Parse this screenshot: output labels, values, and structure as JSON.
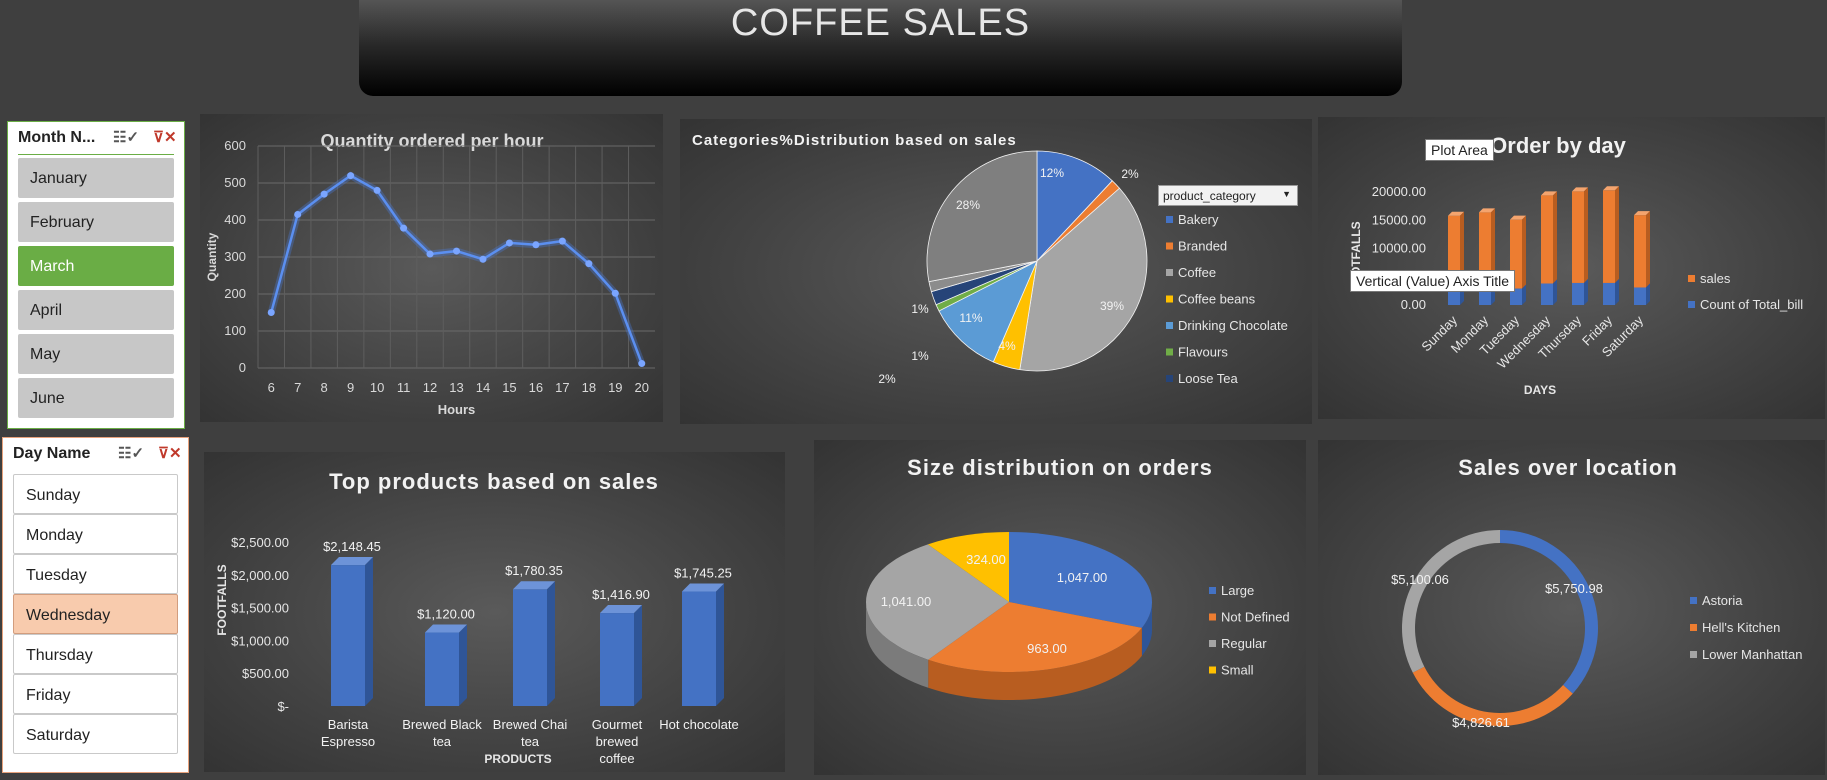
{
  "header": {
    "title": "COFFEE  SALES"
  },
  "month_slicer": {
    "title": "Month N...",
    "items": [
      "January",
      "February",
      "March",
      "April",
      "May",
      "June"
    ],
    "selected": "March",
    "multi_select_icon": "multi-select-icon",
    "clear_filter_icon": "clear-filter-icon"
  },
  "day_slicer": {
    "title": "Day Name",
    "items": [
      "Sunday",
      "Monday",
      "Tuesday",
      "Wednesday",
      "Thursday",
      "Friday",
      "Saturday"
    ],
    "selected": "Wednesday"
  },
  "colors": {
    "blue": "#4472c4",
    "orange": "#ed7d31",
    "gray": "#a5a5a5",
    "yellow": "#ffc000",
    "lightblue": "#5b9bd5",
    "green": "#70ad47",
    "navy": "#264478",
    "slicer_selected_month": "#6aad45",
    "slicer_selected_day": "#f8cbad"
  },
  "chart_data": [
    {
      "id": "hourly",
      "type": "line",
      "title": "Quantity ordered per hour",
      "xlabel": "Hours",
      "ylabel": "Quantity",
      "x": [
        "6",
        "7",
        "8",
        "9",
        "10",
        "11",
        "12",
        "13",
        "14",
        "15",
        "16",
        "17",
        "18",
        "19",
        "20"
      ],
      "y": [
        150,
        415,
        470,
        520,
        480,
        378,
        308,
        316,
        294,
        338,
        333,
        343,
        282,
        202,
        12
      ],
      "ylim": [
        0,
        600
      ],
      "yticks": [
        "0",
        "100",
        "200",
        "300",
        "400",
        "500",
        "600"
      ],
      "grid": true
    },
    {
      "id": "categories",
      "type": "pie",
      "title": "Categories%Distribution based on sales",
      "filter_label": "product_category",
      "legend": [
        "Bakery",
        "Branded",
        "Coffee",
        "Coffee beans",
        "Drinking Chocolate",
        "Flavours",
        "Loose Tea"
      ],
      "slice_labels": [
        "12%",
        "2%",
        "39%",
        "4%",
        "11%",
        "1%",
        "2%",
        "1%",
        "28%"
      ],
      "series": [
        {
          "name": "Bakery",
          "value": 12
        },
        {
          "name": "Branded",
          "value": 1.5
        },
        {
          "name": "Coffee",
          "value": 39
        },
        {
          "name": "Coffee beans",
          "value": 4
        },
        {
          "name": "Drinking Chocolate",
          "value": 11
        },
        {
          "name": "Flavours",
          "value": 1
        },
        {
          "name": "Loose Tea",
          "value": 2
        },
        {
          "name": "Coffee",
          "value": 1.5
        },
        {
          "name": "Coffee",
          "value": 28
        }
      ]
    },
    {
      "id": "byday",
      "type": "bar",
      "title": "Order by day",
      "xlabel": "DAYS",
      "ylabel": "FOOTFALLS",
      "categories": [
        "Sunday",
        "Monday",
        "Tuesday",
        "Wednesday",
        "Thursday",
        "Friday",
        "Saturday"
      ],
      "series": [
        {
          "name": "sales",
          "values": [
            15800,
            16400,
            15100,
            19400,
            20100,
            20300,
            15900
          ]
        },
        {
          "name": "Count of Total_bill",
          "values": [
            3000,
            3100,
            2900,
            3800,
            3900,
            3900,
            3100
          ]
        }
      ],
      "yticks": [
        "0.00",
        "5000.00",
        "10000.00",
        "15000.00",
        "20000.00"
      ],
      "ylim": [
        0,
        20000
      ],
      "tooltips": [
        "Plot Area",
        "Vertical (Value) Axis Title"
      ]
    },
    {
      "id": "products",
      "type": "bar",
      "title": "Top products based on sales",
      "xlabel": "PRODUCTS",
      "ylabel": "FOOTFALLS",
      "categories": [
        [
          "Barista",
          "Espresso"
        ],
        [
          "Brewed Black",
          "tea"
        ],
        [
          "Brewed Chai",
          "tea"
        ],
        [
          "Gourmet",
          "brewed",
          "coffee"
        ],
        [
          "Hot chocolate"
        ]
      ],
      "values": [
        2148.45,
        1120.0,
        1780.35,
        1416.9,
        1745.25
      ],
      "value_labels": [
        "$2,148.45",
        "$1,120.00",
        "$1,780.35",
        "$1,416.90",
        "$1,745.25"
      ],
      "yticks": [
        "$-",
        "$500.00",
        "$1,000.00",
        "$1,500.00",
        "$2,000.00",
        "$2,500.00"
      ],
      "ylim": [
        0,
        2500
      ]
    },
    {
      "id": "sizes",
      "type": "pie",
      "title": "Size distribution on orders",
      "legend": [
        "Large",
        "Not Defined",
        "Regular",
        "Small"
      ],
      "values": [
        1047,
        963,
        1041,
        324
      ],
      "value_labels": [
        "1,047.00",
        "963.00",
        "1,041.00",
        "324.00"
      ]
    },
    {
      "id": "locations",
      "type": "pie",
      "title": "Sales over location",
      "legend": [
        "Astoria",
        "Hell's Kitchen",
        "Lower Manhattan"
      ],
      "values": [
        5750.98,
        4826.61,
        5100.06
      ],
      "value_labels": [
        "$5,750.98",
        "$4,826.61",
        "$5,100.06"
      ]
    }
  ]
}
